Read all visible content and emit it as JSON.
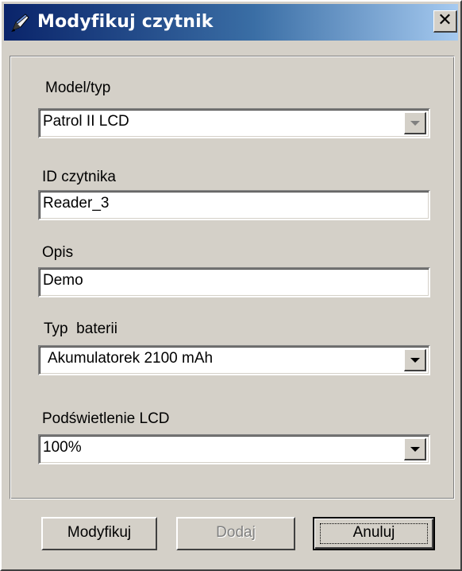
{
  "window": {
    "title": "Modyfikuj czytnik",
    "close_icon": "close-icon",
    "title_icon": "pen-icon"
  },
  "form": {
    "model": {
      "label": "Model/typ",
      "value": "Patrol II LCD",
      "disabled": true
    },
    "reader_id": {
      "label": "ID czytnika",
      "value": "Reader_3"
    },
    "description": {
      "label": "Opis",
      "value": "Demo"
    },
    "battery": {
      "label": "Typ  baterii",
      "value": "Akumulatorek 2100 mAh"
    },
    "backlight": {
      "label": "Podświetlenie LCD",
      "value": "100%"
    }
  },
  "buttons": {
    "modify": "Modyfikuj",
    "add": "Dodaj",
    "cancel": "Anuluj"
  },
  "colors": {
    "titlebar_start": "#0a246a",
    "titlebar_end": "#a6caf0",
    "face": "#d4d0c8"
  }
}
